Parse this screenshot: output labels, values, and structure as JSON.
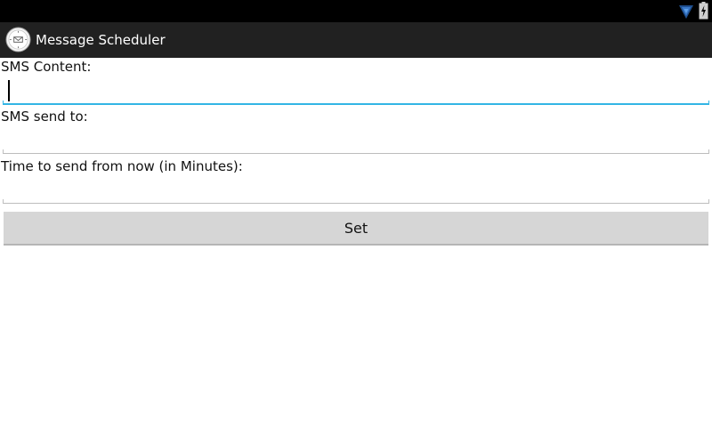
{
  "status_bar": {
    "icons": [
      "wifi-icon",
      "battery-charging-icon"
    ]
  },
  "action_bar": {
    "app_icon": "clock-icon",
    "title": "Message Scheduler"
  },
  "form": {
    "content_label": "SMS Content:",
    "content_value": "",
    "send_to_label": "SMS send to:",
    "send_to_value": "",
    "time_label": "Time to send from now (in Minutes):",
    "time_value": "",
    "set_button": "Set"
  },
  "colors": {
    "action_bar": "#212121",
    "focus_accent": "#33b5e5",
    "button": "#d6d6d6"
  }
}
